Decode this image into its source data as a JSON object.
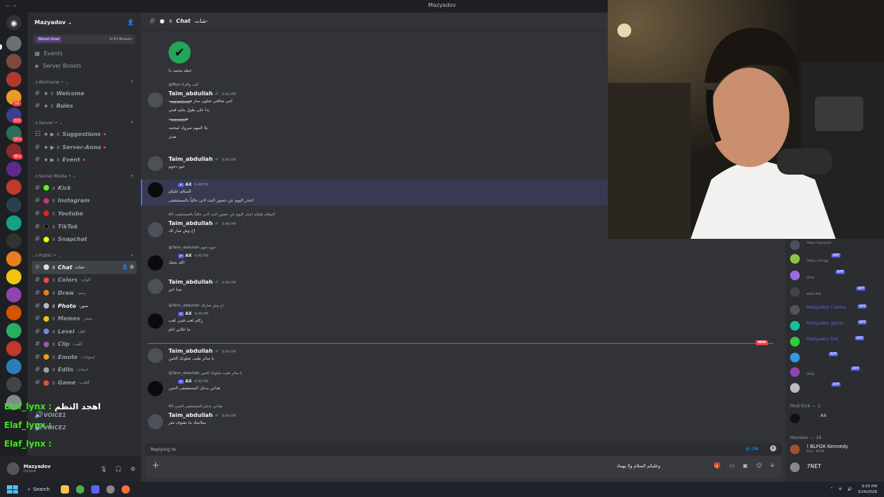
{
  "window": {
    "title": "Mazyadov"
  },
  "server": {
    "name": "Mazyadov",
    "boost_label": "Boost Goal",
    "boost_count": "5/33 Boosts",
    "misc": [
      "Events",
      "Server Boosts"
    ],
    "categories": [
      {
        "name": "Welcome",
        "channels": [
          {
            "name": "Welcome"
          },
          {
            "name": "Rules"
          }
        ]
      },
      {
        "name": "Server",
        "channels": [
          {
            "name": "Suggestions"
          },
          {
            "name": "Server-Anno"
          },
          {
            "name": "Event"
          }
        ]
      },
      {
        "name": "Social Media",
        "channels": [
          {
            "name": "Kick"
          },
          {
            "name": "Instagram"
          },
          {
            "name": "Youtube"
          },
          {
            "name": "TikTok"
          },
          {
            "name": "Snapchat"
          }
        ]
      },
      {
        "name": "Public",
        "channels": [
          {
            "name": "Chat",
            "suffix": "شات-",
            "active": true
          },
          {
            "name": "Colors",
            "suffix": "-الوان"
          },
          {
            "name": "Draw",
            "suffix": "-رسم"
          },
          {
            "name": "Photo",
            "suffix": "-صور"
          },
          {
            "name": "Memes",
            "suffix": "-ميمز"
          },
          {
            "name": "Level",
            "suffix": "-لفل"
          },
          {
            "name": "Clip",
            "suffix": "-كليب"
          },
          {
            "name": "Emote",
            "suffix": "-ايموتات"
          },
          {
            "name": "Edits",
            "suffix": "-اديتات"
          },
          {
            "name": "Game",
            "suffix": "-العاب"
          }
        ]
      }
    ],
    "voice": [
      "VOICE1",
      "VOICE2"
    ]
  },
  "user": {
    "name": "Mazyadov",
    "status": "Online"
  },
  "chat": {
    "channel_name": "Chat",
    "channel_suffix": "شات-",
    "top_caption": "حطه محمد دا",
    "messages": [
      {
        "reply": "@Mys كتب واقراء",
        "author": "Taim_abdullah",
        "time": "6:40 PM",
        "lines": [
          "انتي شافتي شلون صار هههههههههههه",
          "هههههههههههههه",
          "بدا على طول بتايم قبني",
          "هههههههههه",
          "يلا المهم مبروك لمحمد",
          "هدى"
        ]
      },
      {
        "author": "Taim_abdullah",
        "time": "6:48 PM",
        "lines": [
          "حيو دحوم"
        ]
      },
      {
        "author": "AX",
        "time": "6:48 PM",
        "lines": [
          "السلام عليكم",
          "اعتذر اليوم عن حضور البث لاني حالياً بالمستشفى"
        ]
      },
      {
        "reply": "AX السلام عليكم اعتذر اليوم عن حضور البث لاني حالياً بالمستشفى",
        "author": "Taim_abdullah",
        "time": "6:48 PM",
        "lines": [
          "اح وش صار لك"
        ]
      },
      {
        "reply": "@Taim_abdullah حيو دحوم",
        "author": "AX",
        "time": "6:48 PM",
        "lines": [
          "الله يحيك"
        ]
      },
      {
        "author": "Taim_abdullah",
        "time": "6:48 PM",
        "lines": [
          "صبا خير"
        ]
      },
      {
        "reply": "@Taim_abdullah اح وش صارلك",
        "author": "AX",
        "time": "6:49 PM",
        "lines": [
          "زكام لعب فيني لعب",
          "ما خلاني انام"
        ]
      },
      {
        "author": "Taim_abdullah",
        "time": "6:49 PM",
        "lines": [
          "يا ساتر طيب شلونك الحين"
        ]
      },
      {
        "reply": "@Taim_abdullah يا ساتر طيب شلونك الحين",
        "author": "AX",
        "time": "6:49 PM",
        "lines": [
          "هذاني بدخل المستشفى الحين"
        ]
      },
      {
        "reply": "AX هذاني بدخل المستشفى الحين",
        "author": "Taim_abdullah",
        "time": "6:49 PM",
        "lines": [
          "سلامتك ما تشوف شر"
        ]
      }
    ],
    "new_label": "NEW",
    "replying_label": "Replying to",
    "mention_toggle": "@ ON",
    "composer_value": "وعليكم السلام ولا يهمك"
  },
  "members": {
    "bots": [
      {
        "name": "",
        "sub": "https://appy.bot"
      },
      {
        "name": "",
        "sub": "/help | carl.gg",
        "tag": "APP"
      },
      {
        "name": "",
        "sub": "/play",
        "tag": "APP"
      },
      {
        "name": "",
        "sub": "wicks.bot",
        "tag": "APP"
      },
      {
        "name": "Mazyadov Cabins",
        "sub": "",
        "tag": "APP"
      },
      {
        "name": "Mazyadov game",
        "sub": "",
        "tag": "APP"
      },
      {
        "name": "Mazyadov bot",
        "sub": "",
        "tag": "APP"
      },
      {
        "name": "",
        "sub": "",
        "tag": "APP"
      },
      {
        "name": "",
        "sub": "/help",
        "tag": "APP"
      },
      {
        "name": "",
        "sub": "",
        "tag": "APP"
      }
    ],
    "mod_group": "Mod Kick — 1",
    "mod_member": "AX",
    "member_group": "Member — 16",
    "member_list": [
      {
        "name": "! BLFOX Kennedy",
        "sub": "Kick : BFOX"
      },
      {
        "name": "7NET",
        "sub": ""
      }
    ]
  },
  "overlay": {
    "name": "Elaf_lynx",
    "text": "اهجد النظم"
  },
  "taskbar": {
    "search": "Search",
    "time": "6:55 PM",
    "date": "3/24/2026"
  },
  "colors": {
    "accent": "#5865f2",
    "online": "#23a55a",
    "danger": "#f23f43"
  }
}
